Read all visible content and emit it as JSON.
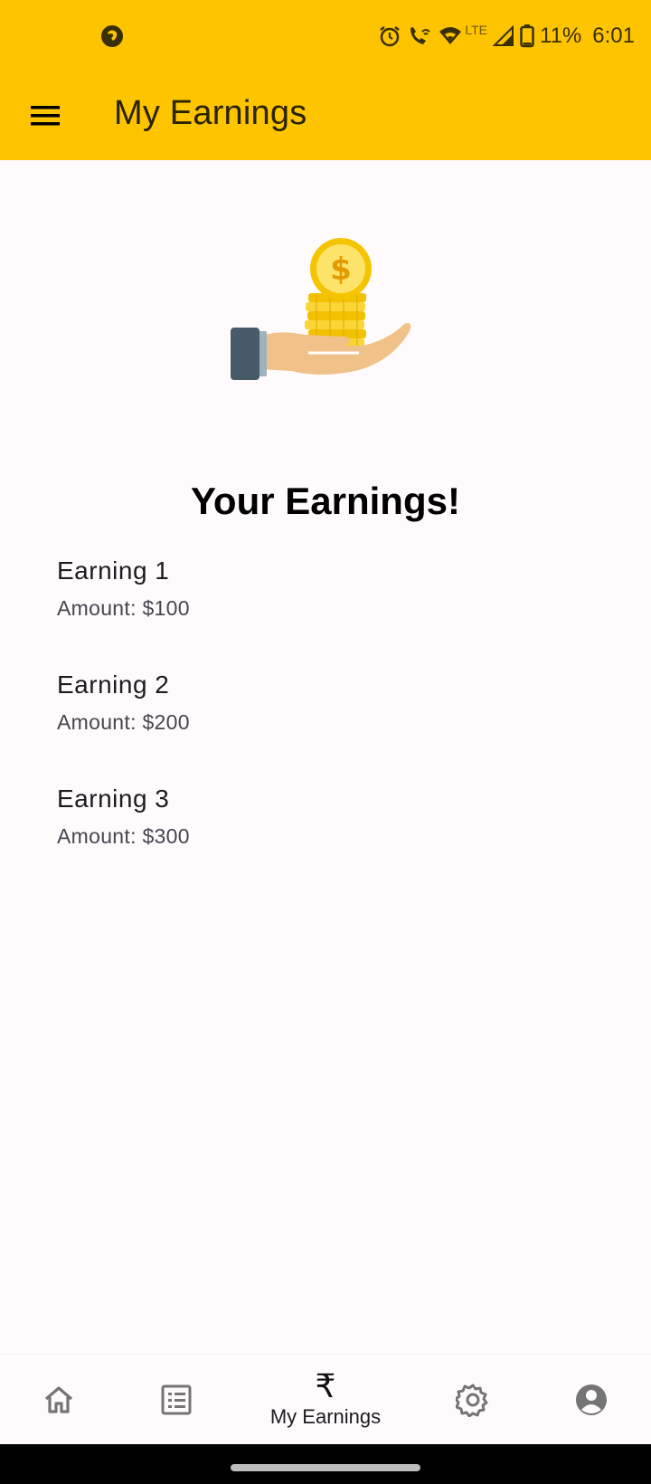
{
  "status_bar": {
    "battery": "11%",
    "time": "6:01",
    "network": "LTE",
    "icons": [
      "app-notification-icon",
      "alarm-icon",
      "wifi-call-icon",
      "wifi-icon",
      "signal-icon",
      "battery-icon"
    ]
  },
  "app_bar": {
    "title": "My Earnings",
    "menu_icon": "hamburger-menu-icon"
  },
  "hero": {
    "image": "hand-holding-coins-illustration"
  },
  "heading": "Your Earnings!",
  "earnings": [
    {
      "title": "Earning 1",
      "amount": "Amount: $100"
    },
    {
      "title": "Earning 2",
      "amount": "Amount: $200"
    },
    {
      "title": "Earning 3",
      "amount": "Amount: $300"
    }
  ],
  "bottom_nav": {
    "items": [
      {
        "icon": "home-icon",
        "label": ""
      },
      {
        "icon": "list-icon",
        "label": ""
      },
      {
        "icon": "rupee-icon",
        "label": "My Earnings",
        "glyph": "₹",
        "selected": true
      },
      {
        "icon": "settings-icon",
        "label": ""
      },
      {
        "icon": "account-icon",
        "label": ""
      }
    ]
  },
  "colors": {
    "app_bar": "#ffc400",
    "background": "#fffbfd",
    "nav_icon_inactive": "#757575"
  }
}
